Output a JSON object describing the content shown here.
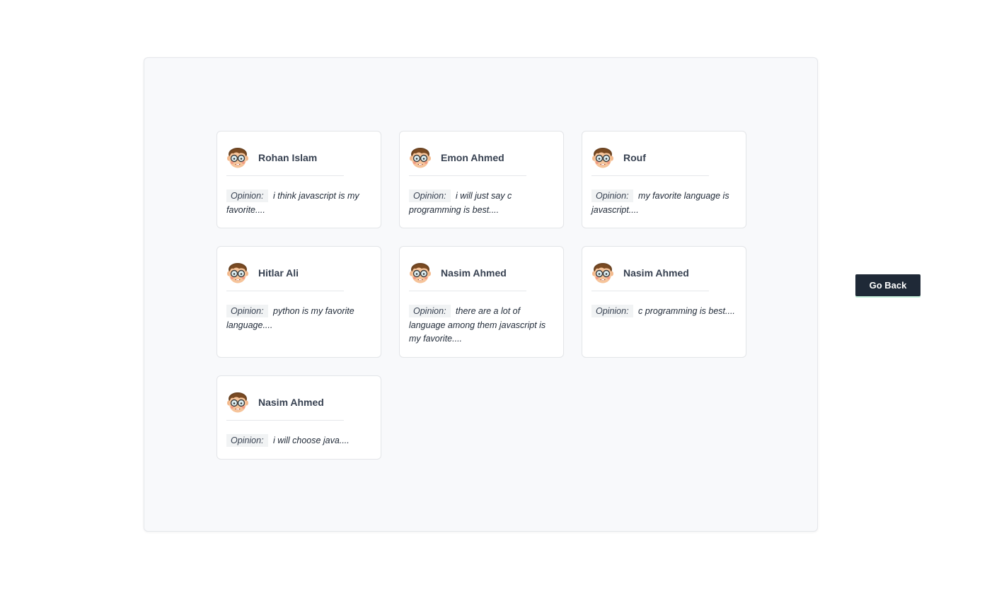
{
  "opinion_label": "Opinion:",
  "cards": [
    {
      "name": "Rohan Islam",
      "opinion": "i think javascript is my favorite....",
      "avatar": "nerd-avatar-icon"
    },
    {
      "name": "Emon Ahmed",
      "opinion": "i will just say c programming is best....",
      "avatar": "nerd-avatar-icon"
    },
    {
      "name": "Rouf",
      "opinion": "my favorite language is javascript....",
      "avatar": "nerd-avatar-icon"
    },
    {
      "name": "Hitlar Ali",
      "opinion": "python is my favorite language....",
      "avatar": "nerd-avatar-icon"
    },
    {
      "name": "Nasim Ahmed",
      "opinion": "there are a lot of language among them javascript is my favorite....",
      "avatar": "nerd-avatar-icon"
    },
    {
      "name": "Nasim Ahmed",
      "opinion": "c programming is best....",
      "avatar": "nerd-avatar-icon"
    },
    {
      "name": "Nasim Ahmed",
      "opinion": "i will choose java....",
      "avatar": "nerd-avatar-icon"
    }
  ],
  "go_back_label": "Go Back",
  "colors": {
    "button_bg": "#1f2937",
    "panel_bg": "#f8f9fb",
    "name_text": "#374151"
  }
}
